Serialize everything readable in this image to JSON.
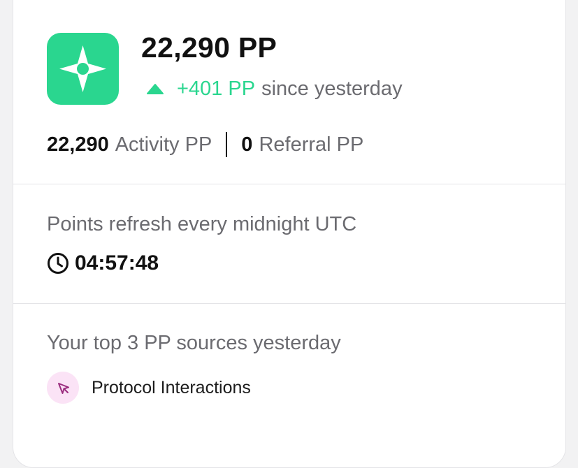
{
  "points": {
    "total": "22,290 PP",
    "delta_value": "+401 PP",
    "delta_suffix": "since yesterday",
    "activity_value": "22,290",
    "activity_label": "Activity PP",
    "referral_value": "0",
    "referral_label": "Referral PP"
  },
  "refresh": {
    "text": "Points refresh every midnight UTC",
    "countdown": "04:57:48"
  },
  "sources": {
    "title": "Your top 3 PP sources yesterday",
    "items": [
      {
        "label": "Protocol Interactions",
        "icon": "cursor-click-icon"
      }
    ]
  },
  "colors": {
    "accent": "#2ad68f",
    "muted_text": "#6b6b70",
    "source_icon_bg": "#fbe3f6",
    "source_icon_stroke": "#9b2d7f"
  }
}
